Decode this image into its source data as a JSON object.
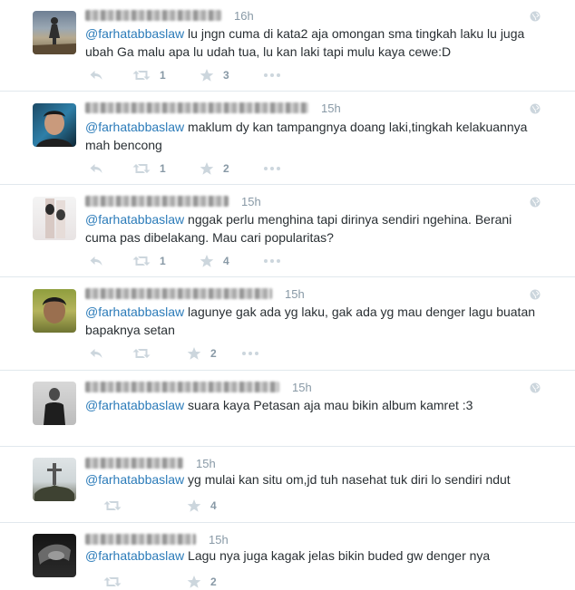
{
  "tweets": [
    {
      "time": "16h",
      "mention": "@farhatabbaslaw",
      "text": " lu jngn cuma di kata2 aja omongan sma tingkah laku lu juga ubah Ga malu apa lu udah tua, lu kan laki tapi mulu  kaya cewe:D",
      "retweets": "1",
      "favorites": "3"
    },
    {
      "time": "15h",
      "mention": "@farhatabbaslaw",
      "text": " maklum dy kan tampangnya doang laki,tingkah kelakuannya mah bencong",
      "retweets": "1",
      "favorites": "2"
    },
    {
      "time": "15h",
      "mention": "@farhatabbaslaw",
      "text": " nggak perlu menghina tapi dirinya sendiri ngehina. Berani cuma pas dibelakang. Mau cari popularitas?",
      "retweets": "1",
      "favorites": "4"
    },
    {
      "time": "15h",
      "mention": "@farhatabbaslaw",
      "text": " lagunye gak ada yg laku, gak ada yg mau denger lagu buatan bapaknya setan",
      "retweets": "",
      "favorites": "2"
    },
    {
      "time": "15h",
      "mention": "@farhatabbaslaw",
      "text": " suara kaya Petasan aja mau bikin album kamret :3",
      "retweets": "",
      "favorites": ""
    },
    {
      "time": "15h",
      "mention": "@farhatabbaslaw",
      "text": " yg mulai kan situ om,jd tuh nasehat tuk diri lo sendiri ndut",
      "retweets": "",
      "favorites": "4"
    },
    {
      "time": "15h",
      "mention": "@farhatabbaslaw",
      "text": " Lagu nya juga kagak jelas bikin buded gw denger nya",
      "retweets": "",
      "favorites": "2"
    }
  ],
  "icons": {
    "reply": "reply-icon",
    "retweet": "retweet-icon",
    "favorite": "star-icon",
    "more": "more-icon",
    "globe": "globe-icon"
  },
  "colors": {
    "mention": "#2b7bb9",
    "meta": "#8899a6",
    "icon": "#ccd6dd",
    "border": "#e1e8ed"
  }
}
